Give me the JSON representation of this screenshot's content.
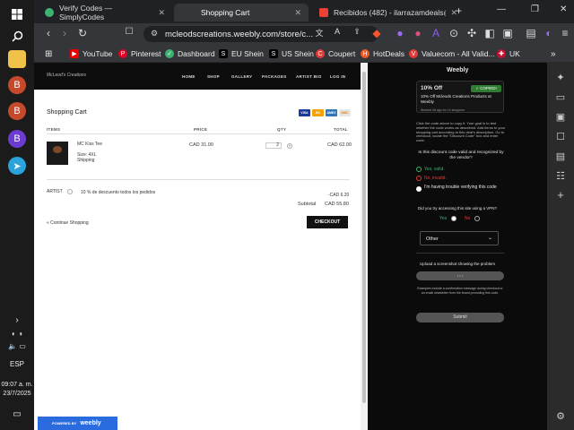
{
  "taskbar": {
    "language": "ESP",
    "time": "09:07 a. m.",
    "date": "23/7/2025"
  },
  "tabs": [
    {
      "title": "Verify Codes — SimplyCodes",
      "active": false
    },
    {
      "title": "Shopping Cart",
      "active": true
    },
    {
      "title": "Recibidos (482) - ilarrazamdeals@gm",
      "active": false
    }
  ],
  "address_bar": {
    "url": "mcleodscreations.weebly.com/store/c..."
  },
  "bookmarks": [
    "YouTube",
    "Pinterest",
    "Dashboard",
    "EU Shein",
    "US Shein",
    "Coupert",
    "HotDeals",
    "Valuecom - All Valid...",
    "UK"
  ],
  "site": {
    "logo": "McLeod's Creations",
    "nav": [
      "HOME",
      "SHOP",
      "GALLERY",
      "PACKAGES",
      "ARTIST BIO",
      "LOG IN"
    ],
    "cart_title": "Shopping Cart",
    "payment_cards": [
      "VISA",
      "MC",
      "AMEX",
      "DISC"
    ],
    "columns": [
      "ITEMS",
      "PRICE",
      "QTY",
      "TOTAL"
    ],
    "item": {
      "name": "MC Kiss Tee",
      "size": "Size: 4XL",
      "shipping": "Shipping",
      "price": "CAD 31.00",
      "qty": "2",
      "total": "CAD 62.00"
    },
    "discount_code": "ARTIST",
    "discount_desc": "10 % de descuento todos los pedidos",
    "discount_amount": "-CAD 6.20",
    "subtotal_label": "Subtotal",
    "subtotal_value": "CAD 55.80",
    "continue_label": "« Continue Shopping",
    "checkout_label": "CHECKOUT",
    "powered_by": "POWERED BY",
    "weebly": "weebly"
  },
  "extension": {
    "brand": "Weebly",
    "offer_title": "10% Off",
    "copied_label": "✓ COPIED!",
    "offer_desc": "10% Off Mcleods Creations Products at Weebly",
    "offer_meta": "Worked 3d ago for 14 shoppers",
    "instructions": "Click the code above to copy it. Your goal is to test whether the code works as described. Add items to your shopping cart according to this deal's description. Go to checkout, locate the \"Discount Code\" box and enter code.",
    "question_valid": "Is this discount code valid and recognized by the vendor?",
    "opt_valid": "Yes, valid.",
    "opt_invalid": "No, invalid.",
    "opt_trouble": "I'm having trouble verifying this code",
    "question_vpn": "Did you try accessing this site using a VPN?",
    "vpn_yes": "Yes",
    "vpn_no": "No",
    "select_value": "Other",
    "upload_label": "Upload a screenshot showing the problem",
    "upload_button": "• • •",
    "examples_text": "Examples include a confirmation message during checkout or an email newsletter from the brand promoting this code.",
    "submit": "Submit"
  }
}
